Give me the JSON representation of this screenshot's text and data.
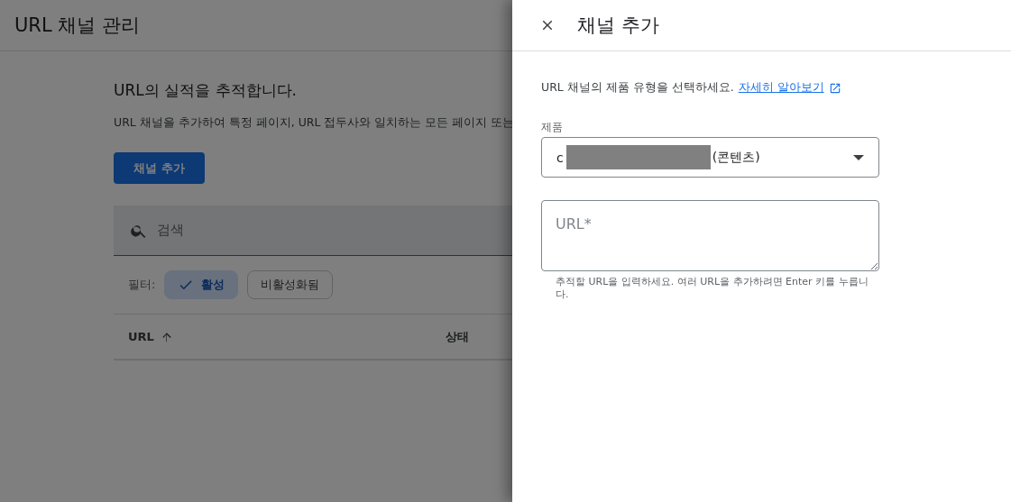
{
  "page": {
    "title": "URL 채널 관리",
    "heading": "URL의 실적을 추적합니다.",
    "description": "URL 채널을 추가하여 특정 페이지, URL 접두사와 일치하는 모든 페이지 또는",
    "add_button": "채널 추가",
    "search": {
      "placeholder": "검색"
    },
    "filter_label": "필터:",
    "filters": [
      {
        "label": "활성",
        "selected": true
      },
      {
        "label": "비활성화됨",
        "selected": false
      }
    ],
    "table": {
      "columns": [
        {
          "label": "URL",
          "sorted": true
        },
        {
          "label": "상태",
          "sorted": false
        }
      ]
    }
  },
  "drawer": {
    "title": "채널 추가",
    "intro": "URL 채널의 제품 유형을 선택하세요.",
    "link": "자세히 알아보기",
    "product": {
      "label": "제품",
      "value_start": "c",
      "redacted": true,
      "value_end": "(콘텐츠)"
    },
    "url_field": {
      "placeholder": "URL*",
      "helper": "추적할 URL을 입력하세요. 여러 URL을 추가하려면 Enter 키를 누릅니다."
    }
  }
}
